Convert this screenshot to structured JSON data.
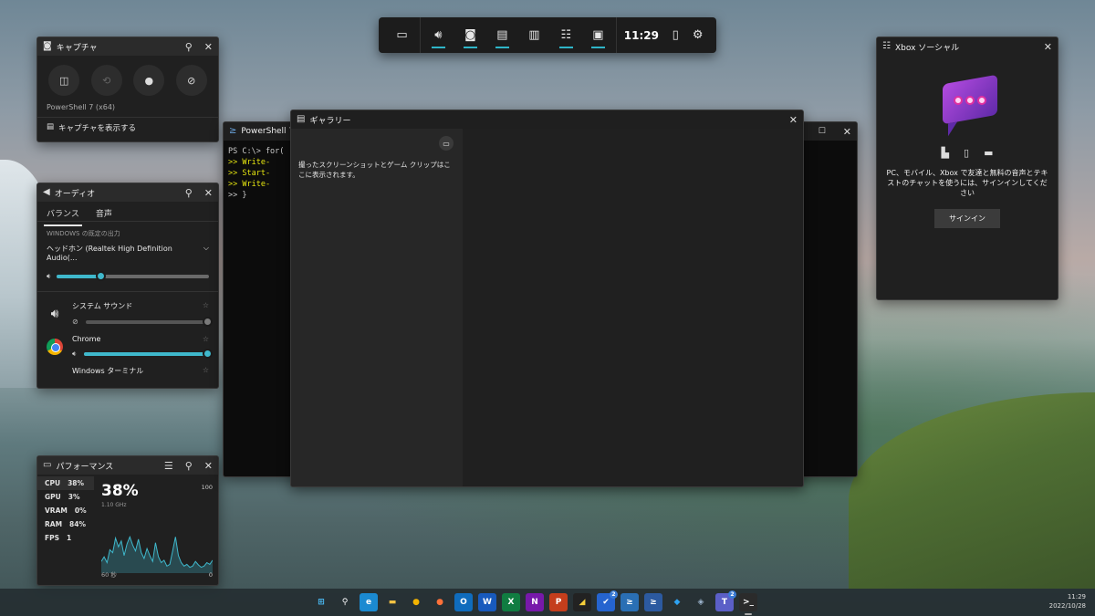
{
  "gamebar": {
    "time": "11:29"
  },
  "capture": {
    "title": "キャプチャ",
    "app_name": "PowerShell 7 (x64)",
    "show_captures": "キャプチャを表示する"
  },
  "audio": {
    "title": "オーディオ",
    "tabs": [
      "バランス",
      "音声"
    ],
    "default_output_label": "WINDOWS の既定の出力",
    "device": "ヘッドホン (Realtek High Definition Audio(...",
    "master_volume": 0.29,
    "apps": [
      {
        "name": "システム サウンド",
        "volume": 1.0,
        "muted": true
      },
      {
        "name": "Chrome",
        "volume": 1.0,
        "muted": false
      },
      {
        "name": "Windows ターミナル"
      }
    ]
  },
  "performance": {
    "title": "パフォーマンス",
    "metrics": [
      {
        "label": "CPU",
        "value": "38%"
      },
      {
        "label": "GPU",
        "value": "3%"
      },
      {
        "label": "VRAM",
        "value": "0%"
      },
      {
        "label": "RAM",
        "value": "84%"
      },
      {
        "label": "FPS",
        "value": "1"
      }
    ],
    "big_value": "38%",
    "freq": "1.10 GHz",
    "max": "100",
    "min": "0",
    "window": "60 秒",
    "history": [
      20,
      28,
      18,
      40,
      35,
      60,
      45,
      55,
      30,
      50,
      62,
      48,
      38,
      58,
      35,
      25,
      42,
      30,
      20,
      52,
      28,
      18,
      22,
      12,
      15,
      38,
      62,
      30,
      18,
      12,
      15,
      10,
      12,
      20,
      14,
      10,
      12,
      18,
      15,
      22
    ]
  },
  "terminal": {
    "title": "PowerShell 7 (",
    "lines": [
      "PS C:\\> for(",
      ">>     Write-",
      ">>     Start-",
      ">>     Write-",
      ">> }"
    ]
  },
  "gallery": {
    "title": "ギャラリー",
    "empty_text": "撮ったスクリーンショットとゲーム クリップはここに表示されます。"
  },
  "social": {
    "title": "Xbox ソーシャル",
    "message": "PC、モバイル、Xbox で友達と無料の音声とテキストのチャットを使うには、サインインしてください",
    "signin": "サインイン"
  },
  "taskbar": {
    "time": "11:29",
    "date": "2022/10/28",
    "apps": [
      {
        "name": "start",
        "glyph": "⊞",
        "color": "#4cc2ff",
        "bg": "transparent"
      },
      {
        "name": "search",
        "glyph": "⚲",
        "color": "#ffffff",
        "bg": "transparent"
      },
      {
        "name": "edge",
        "glyph": "e",
        "color": "#ffffff",
        "bg": "#1b8ad1"
      },
      {
        "name": "explorer",
        "glyph": "▬",
        "color": "#f6c343",
        "bg": "transparent"
      },
      {
        "name": "chrome",
        "glyph": "●",
        "color": "#f4b400",
        "bg": "transparent"
      },
      {
        "name": "firefox",
        "glyph": "●",
        "color": "#ff7139",
        "bg": "transparent"
      },
      {
        "name": "outlook",
        "glyph": "O",
        "color": "#ffffff",
        "bg": "#0f6cbd"
      },
      {
        "name": "word",
        "glyph": "W",
        "color": "#ffffff",
        "bg": "#185abd"
      },
      {
        "name": "excel",
        "glyph": "X",
        "color": "#ffffff",
        "bg": "#107c41"
      },
      {
        "name": "onenote",
        "glyph": "N",
        "color": "#ffffff",
        "bg": "#7719aa"
      },
      {
        "name": "powerpoint",
        "glyph": "P",
        "color": "#ffffff",
        "bg": "#c43e1c"
      },
      {
        "name": "sticky-notes",
        "glyph": "◢",
        "color": "#f7d03a",
        "bg": "#222"
      },
      {
        "name": "todo",
        "glyph": "✔",
        "color": "#ffffff",
        "bg": "#2564cf",
        "badge": "2"
      },
      {
        "name": "azure-ps",
        "glyph": "≥",
        "color": "#ffffff",
        "bg": "#2a6fb4"
      },
      {
        "name": "powershell",
        "glyph": "≥",
        "color": "#ffffff",
        "bg": "#2c5aa0"
      },
      {
        "name": "vscode",
        "glyph": "◆",
        "color": "#2ea3f2",
        "bg": "transparent"
      },
      {
        "name": "app-misc",
        "glyph": "◈",
        "color": "#9fb7d0",
        "bg": "transparent"
      },
      {
        "name": "teams",
        "glyph": "T",
        "color": "#ffffff",
        "bg": "#5b5fc7",
        "badge": "2"
      },
      {
        "name": "terminal",
        "glyph": ">_",
        "color": "#ffffff",
        "bg": "#2b2b2b",
        "active": true
      }
    ]
  },
  "colors": {
    "accent": "#3fb8cc"
  }
}
